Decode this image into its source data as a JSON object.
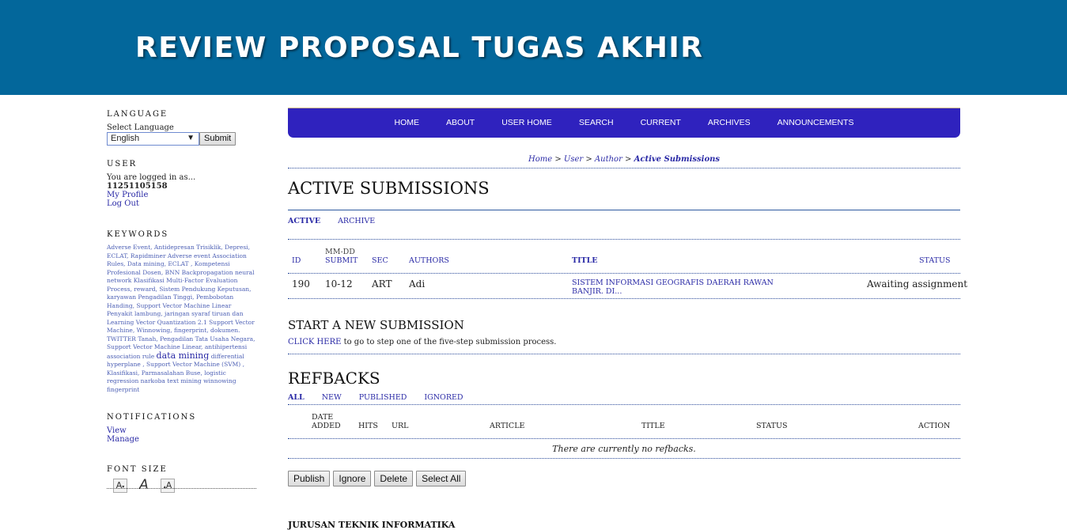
{
  "site": {
    "title": "REVIEW PROPOSAL TUGAS AKHIR"
  },
  "sidebar": {
    "language": {
      "title": "LANGUAGE",
      "label": "Select Language",
      "selected": "English",
      "submit": "Submit"
    },
    "user": {
      "title": "USER",
      "logged_in_as": "You are logged in as...",
      "username": "11251105158",
      "my_profile": "My Profile",
      "log_out": "Log Out"
    },
    "keywords": {
      "title": "KEYWORDS",
      "text_1": "Adverse Event, Antidepresan Trisiklik, Depresi, ECLAT, Rapidminer Adverse event Association Rules, Data mining, ECLAT , Kompetensi Profesional Dosen, BNN Backpropagation neural network Klasifikasi Multi-Factor Evaluation Process, reward, Sistem Pendukung Keputusan, karyawan Pengadilan Tinggi, Pembobotan Handing, Support Vector Machine Linear Penyakit lambung, jaringan syaraf tiruan dan Learning Vector Quantization 2.1 Support Vector Machine, Winnowing, fingerprint, dokumen. TWITTER Tanah, Pengadilan Tata Usaha Negara, Support Vector Machine Linear, antihipertensi association rule",
      "big": "data mining",
      "text_2": "differential hyperplane , Support Vector Machine (SVM) , Klasifikasi, Parmasalahan Buse, logistic regression narkoba text mining winnowing fingerprint"
    },
    "notifications": {
      "title": "NOTIFICATIONS",
      "view": "View",
      "manage": "Manage"
    },
    "font_size": {
      "title": "FONT SIZE",
      "smaller": "A",
      "default": "A",
      "larger": "A"
    }
  },
  "nav": {
    "items": [
      "HOME",
      "ABOUT",
      "USER HOME",
      "SEARCH",
      "CURRENT",
      "ARCHIVES",
      "ANNOUNCEMENTS"
    ]
  },
  "breadcrumb": {
    "home": "Home",
    "user": "User",
    "author": "Author",
    "current": "Active Submissions",
    "sep": ">"
  },
  "page": {
    "title": "ACTIVE SUBMISSIONS"
  },
  "tabs": {
    "active": "ACTIVE",
    "archive": "ARCHIVE"
  },
  "submissions_table": {
    "headers": {
      "id": "ID",
      "mmdd": "MM-DD",
      "submit": "SUBMIT",
      "sec": "SEC",
      "authors": "AUTHORS",
      "title": "TITLE",
      "status": "STATUS"
    },
    "rows": [
      {
        "id": "190",
        "date": "10-12",
        "sec": "ART",
        "authors": "Adi",
        "title_1": "SISTEM INFORMASI GEOGRAFIS DAERAH RAWAN",
        "title_2": "BANJIR. DI...",
        "status": "Awaiting assignment"
      }
    ]
  },
  "new_submission": {
    "title": "START A NEW SUBMISSION",
    "link": "CLICK HERE",
    "text": "to go to step one of the five-step submission process."
  },
  "refbacks": {
    "title": "REFBACKS",
    "tabs": [
      "ALL",
      "NEW",
      "PUBLISHED",
      "IGNORED"
    ],
    "headers": {
      "date": "DATE",
      "added": "ADDED",
      "hits": "HITS",
      "url": "URL",
      "article": "ARTICLE",
      "title": "TITLE",
      "status": "STATUS",
      "action": "ACTION"
    },
    "empty": "There are currently no refbacks."
  },
  "actions": {
    "publish": "Publish",
    "ignore": "Ignore",
    "delete": "Delete",
    "select_all": "Select All"
  },
  "footer": {
    "title": "JURUSAN TEKNIK INFORMATIKA"
  }
}
